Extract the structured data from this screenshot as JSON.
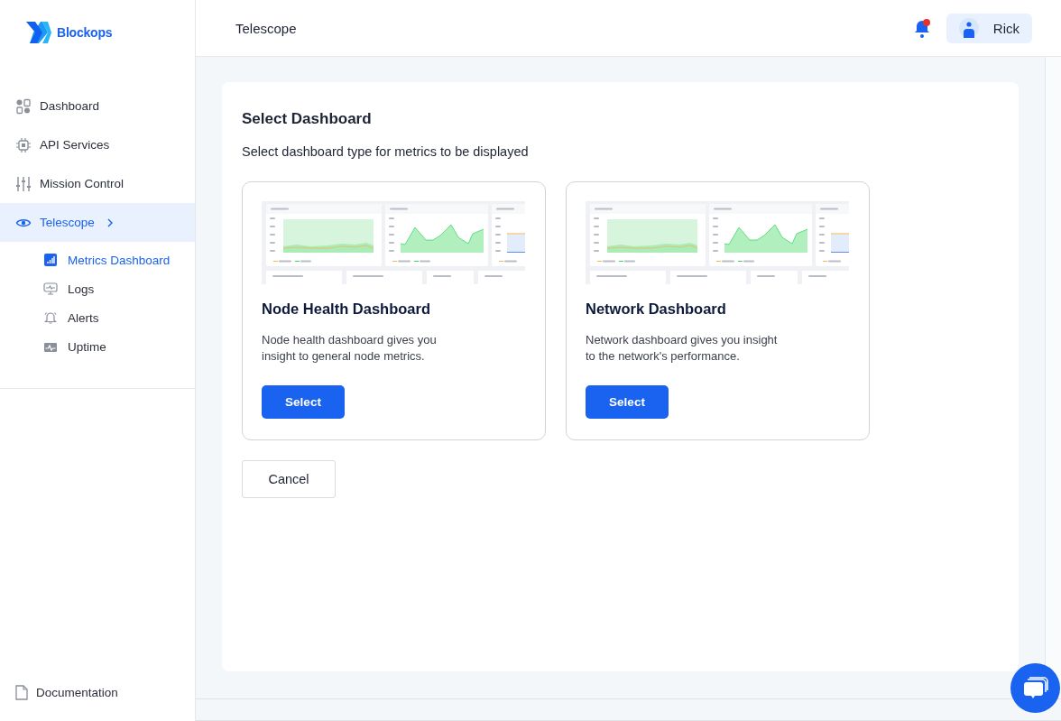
{
  "brand": {
    "name": "Blockops"
  },
  "sidebar": {
    "items": [
      {
        "label": "Dashboard",
        "selected": false
      },
      {
        "label": "API Services",
        "selected": false
      },
      {
        "label": "Mission Control",
        "selected": false
      },
      {
        "label": "Telescope",
        "selected": true,
        "expanded": true,
        "children": [
          {
            "label": "Metrics Dashboard",
            "selected": true
          },
          {
            "label": "Logs",
            "selected": false
          },
          {
            "label": "Alerts",
            "selected": false
          },
          {
            "label": "Uptime",
            "selected": false
          }
        ]
      }
    ],
    "footer_items": [
      {
        "label": "Documentation"
      }
    ]
  },
  "header": {
    "title": "Telescope",
    "notification_unread": true,
    "user": "Rick"
  },
  "panel": {
    "title": "Select Dashboard",
    "subtitle": "Select dashboard type for metrics to be displayed",
    "cards": [
      {
        "title": "Node Health Dashboard",
        "description": "Node health dashboard gives you insight to general node metrics.",
        "button": "Select"
      },
      {
        "title": "Network Dashboard",
        "description": "Network dashboard gives you insight to the network's performance.",
        "button": "Select"
      }
    ],
    "cancel": "Cancel"
  }
}
